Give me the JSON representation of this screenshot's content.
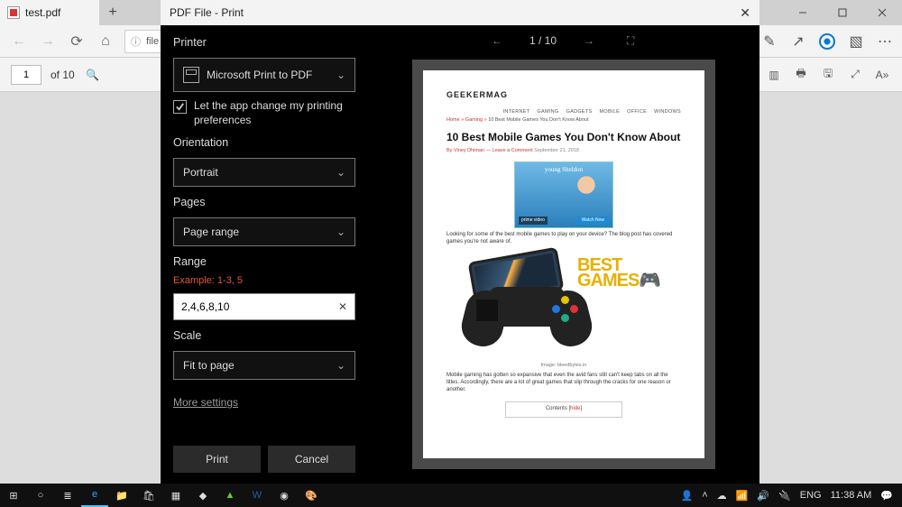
{
  "titlebar": {
    "tab_title": "test.pdf"
  },
  "navbar": {
    "address_prefix": "file"
  },
  "pdfbar": {
    "page_current": "1",
    "page_of": "of 10"
  },
  "dialog": {
    "title": "PDF File - Print",
    "printer_heading": "Printer",
    "printer_value": "Microsoft Print to PDF",
    "let_app_label": "Let the app change my printing preferences",
    "orientation_heading": "Orientation",
    "orientation_value": "Portrait",
    "pages_heading": "Pages",
    "pages_value": "Page range",
    "range_heading": "Range",
    "range_example": "Example: 1-3, 5",
    "range_value": "2,4,6,8,10",
    "scale_heading": "Scale",
    "scale_value": "Fit to page",
    "more_settings": "More settings",
    "print_btn": "Print",
    "cancel_btn": "Cancel",
    "preview_counter": "1  /  10"
  },
  "page": {
    "site": "GEEKERMAG",
    "nav": [
      "INTERNET",
      "GAMING",
      "GADGETS",
      "MOBILE",
      "OFFICE",
      "WINDOWS"
    ],
    "crumb_home": "Home",
    "crumb_cat": "Gaming",
    "crumb_title": "10 Best Mobile Games You Don't Know About",
    "headline": "10 Best Mobile Games You Don't Know About",
    "author": "By Viney Dhiman",
    "leave": "Leave a Comment",
    "date": "September 21, 2018",
    "banner_title": "young Sheldon",
    "banner_prime": "prime video",
    "banner_cta": "Watch Now",
    "lead": "Looking for some of the best mobile games to play on your device? The blog post has covered games you're not aware of.",
    "hero_best": "BEST",
    "hero_games": "GAMES",
    "caption": "Image: bleedbytes.in",
    "body": "Mobile gaming has gotten so expansive that even the avid fans still can't keep tabs on all the titles. Accordingly, there are a lot of great games that slip through the cracks for one reason or another.",
    "toc_label": "Contents",
    "toc_link": "hide"
  },
  "tray": {
    "lang": "ENG",
    "time": "11:38 AM"
  }
}
